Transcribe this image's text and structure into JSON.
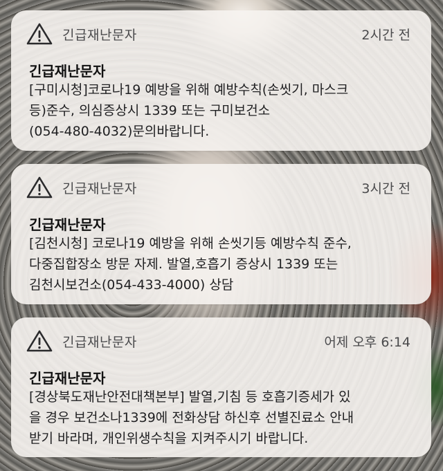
{
  "notifications": [
    {
      "app_name": "긴급재난문자",
      "time": "2시간 전",
      "title": "긴급재난문자",
      "body": "[구미시청]코로나19 예방을 위해 예방수칙(손씻기, 마스크\n등)준수, 의심증상시 1339 또는 구미보건소\n(054-480-4032)문의바랍니다.",
      "icon": "warning-triangle-icon"
    },
    {
      "app_name": "긴급재난문자",
      "time": "3시간 전",
      "title": "긴급재난문자",
      "body": "[김천시청] 코로나19 예방을 위해 손씻기등 예방수칙 준수,\n다중집합장소 방문 자제. 발열,호흡기 증상시 1339 또는\n김천시보건소(054-433-4000) 상담",
      "icon": "warning-triangle-icon"
    },
    {
      "app_name": "긴급재난문자",
      "time": "어제 오후 6:14",
      "title": "긴급재난문자",
      "body": "[경상북도재난안전대책본부] 발열,기침 등 호흡기증세가 있\n을 경우 보건소나1339에 전화상담 하신후 선별진료소 안내\n받기 바라며, 개인위생수칙을 지켜주시기 바랍니다.",
      "icon": "warning-triangle-icon"
    }
  ]
}
